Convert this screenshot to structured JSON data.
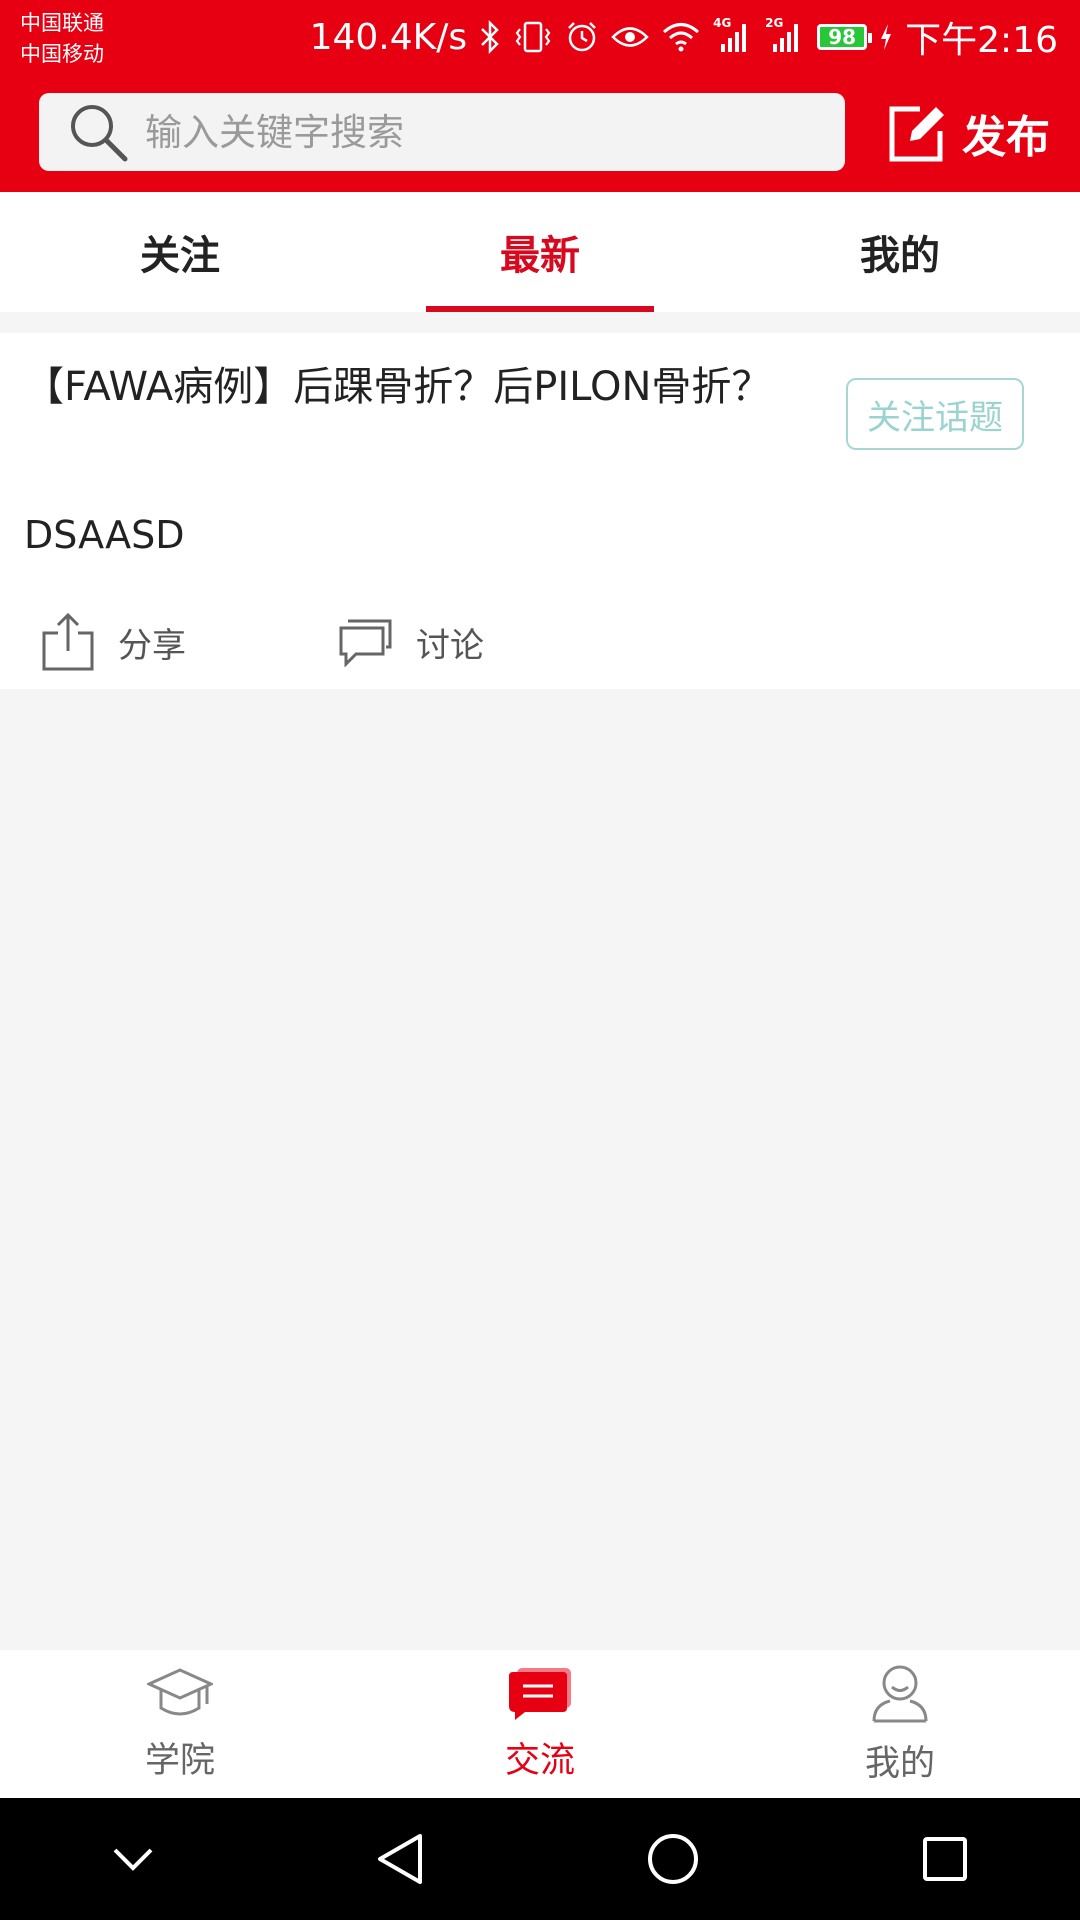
{
  "status_bar": {
    "carrier_1": "中国联通",
    "carrier_2": "中国移动",
    "net_speed": "140.4K/s",
    "signal_1_label": "4G",
    "signal_2_label": "2G",
    "battery": "98",
    "time": "下午2:16"
  },
  "header": {
    "search_placeholder": "输入关键字搜索",
    "publish_label": "发布"
  },
  "tabs": [
    {
      "label": "关注"
    },
    {
      "label": "最新"
    },
    {
      "label": "我的"
    }
  ],
  "post": {
    "title": "【FAWA病例】后踝骨折？后PILON骨折？",
    "follow_topic_label": "关注话题",
    "body": "DSAASD",
    "share_label": "分享",
    "discuss_label": "讨论"
  },
  "bottom_nav": [
    {
      "label": "学院",
      "icon": "graduation-cap-icon"
    },
    {
      "label": "交流",
      "icon": "chat-icon"
    },
    {
      "label": "我的",
      "icon": "user-icon"
    }
  ],
  "colors": {
    "brand_red": "#e60012",
    "tab_active": "#d7091e",
    "follow_topic": "#9ad3cf"
  }
}
